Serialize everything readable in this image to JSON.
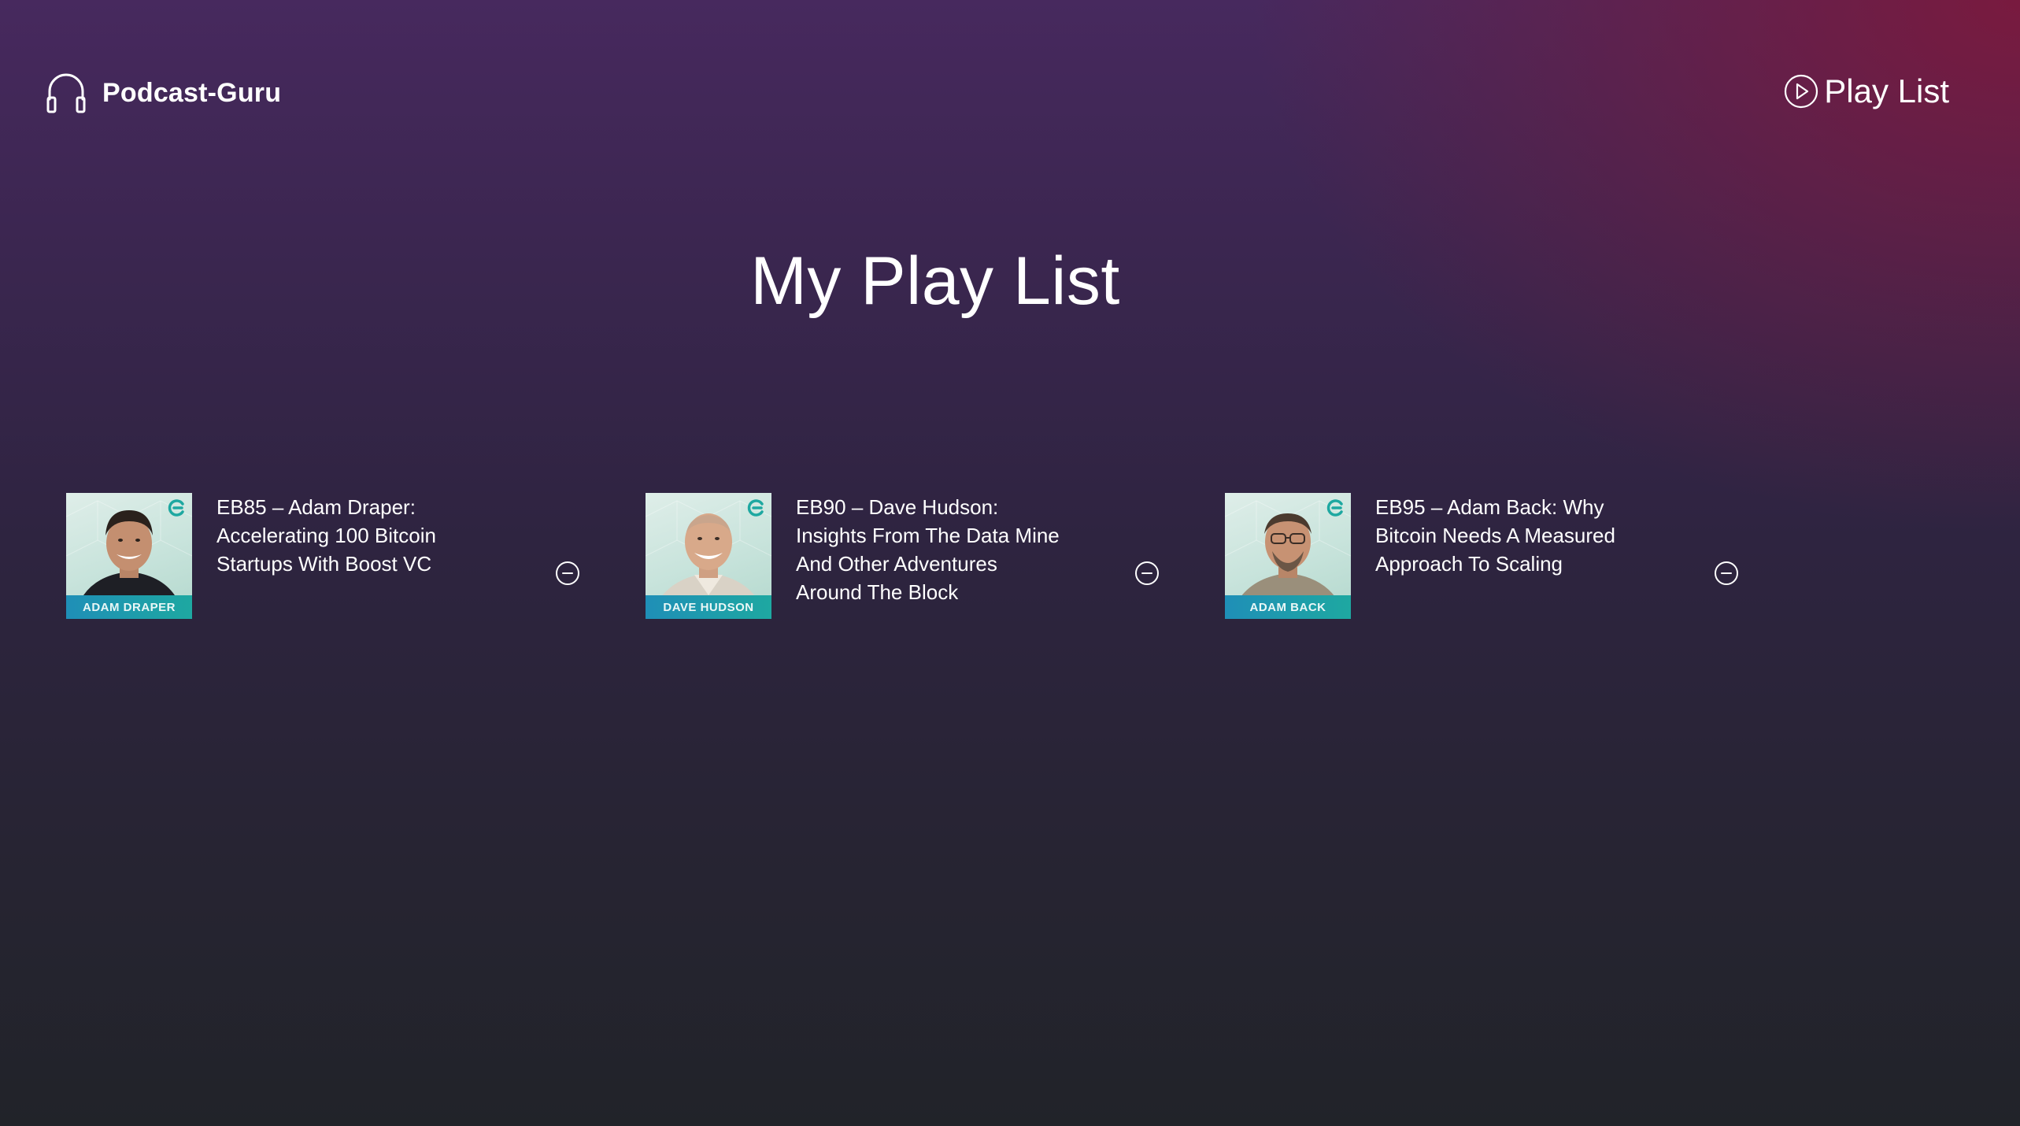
{
  "header": {
    "brand_icon": "headphones-icon",
    "brand_name": "Podcast-Guru",
    "playlist_icon": "play-circle-icon",
    "playlist_label": "Play List"
  },
  "main": {
    "title": "My Play List",
    "episodes": [
      {
        "title": "EB85 – Adam Draper: Accelerating 100 Bitcoin Startups With Boost VC",
        "thumb_label": "ADAM DRAPER",
        "remove_icon": "minus-circle-icon"
      },
      {
        "title": "EB90 – Dave Hudson: Insights From The Data Mine And Other Adventures Around The Block",
        "thumb_label": "DAVE HUDSON",
        "remove_icon": "minus-circle-icon"
      },
      {
        "title": "EB95 – Adam Back: Why Bitcoin Needs A Measured Approach To Scaling",
        "thumb_label": "ADAM BACK",
        "remove_icon": "minus-circle-icon"
      }
    ]
  },
  "colors": {
    "accent": "#1ea8a1",
    "text": "#ffffff"
  }
}
